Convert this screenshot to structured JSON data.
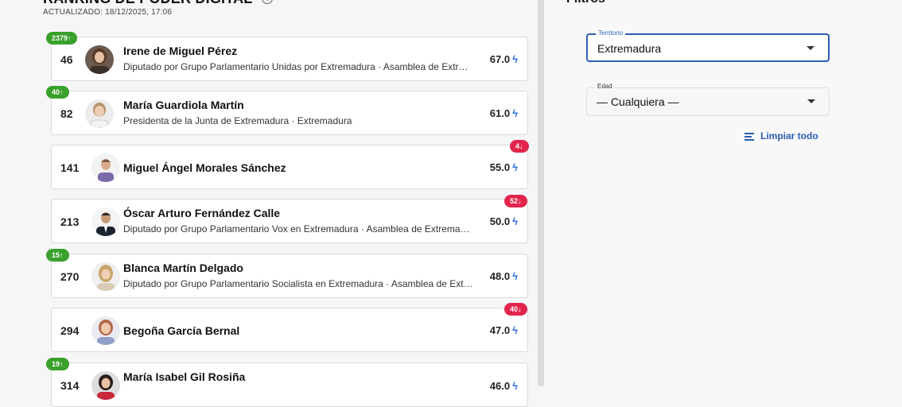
{
  "ranking": {
    "title": "RANKING DE PODER DIGITAL",
    "updated": "ACTUALIZADO: 18/12/2025, 17:06",
    "items": [
      {
        "rank": "46",
        "name": "Irene de Miguel Pérez",
        "desc": "Diputado por Grupo Parlamentario Unidas por Extremadura · Asamblea de Extremadura",
        "score": "67.0",
        "badge": "2379↑",
        "badge_dir": "up"
      },
      {
        "rank": "82",
        "name": "María Guardiola Martín",
        "desc": "Presidenta de la Junta de Extremadura · Extremadura",
        "score": "61.0",
        "badge": "40↑",
        "badge_dir": "up"
      },
      {
        "rank": "141",
        "name": "Miguel Ángel Morales Sánchez",
        "desc": "",
        "score": "55.0",
        "badge": "4↓",
        "badge_dir": "down"
      },
      {
        "rank": "213",
        "name": "Óscar Arturo Fernández Calle",
        "desc": "Diputado por Grupo Parlamentario Vox en Extremadura · Asamblea de Extremadura",
        "score": "50.0",
        "badge": "52↓",
        "badge_dir": "down"
      },
      {
        "rank": "270",
        "name": "Blanca Martín Delgado",
        "desc": "Diputado por Grupo Parlamentario Socialista en Extremadura · Asamblea de Extremadura",
        "score": "48.0",
        "badge": "15↑",
        "badge_dir": "up"
      },
      {
        "rank": "294",
        "name": "Begoña García Bernal",
        "desc": "",
        "score": "47.0",
        "badge": "40↓",
        "badge_dir": "down"
      },
      {
        "rank": "314",
        "name": "María Isabel Gil Rosiña",
        "desc": "",
        "score": "46.0",
        "badge": "19↑",
        "badge_dir": "up"
      }
    ]
  },
  "filters": {
    "title": "Filtros",
    "territory": {
      "label": "Territorio",
      "value": "Extremadura"
    },
    "age": {
      "label": "Edad",
      "value": "— Cualquiera —"
    },
    "clear_label": "Limpiar todo"
  },
  "icons": {
    "info": "info-icon",
    "bolt": "lightning-bolt-icon",
    "caret": "caret-down-icon",
    "clear": "filter-lines-icon"
  },
  "colors": {
    "accent": "#2b5fb3",
    "up_badge": "#3aa02c",
    "down_badge": "#e3254c",
    "bolt": "#2f6fe0"
  }
}
